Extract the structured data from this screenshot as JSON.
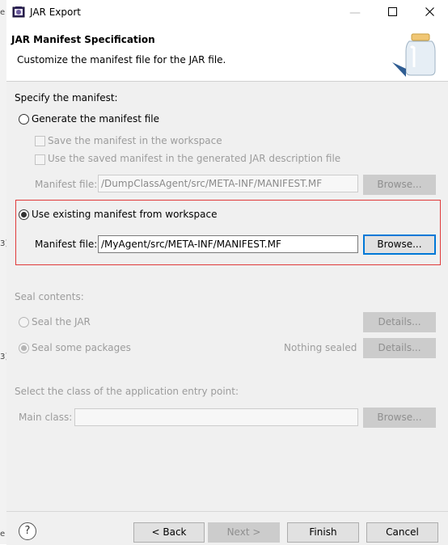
{
  "window": {
    "title": "JAR Export",
    "minimize_glyph": "—",
    "maximize_glyph": "☐",
    "close_glyph": "✕"
  },
  "header": {
    "title": "JAR Manifest Specification",
    "description": "Customize the manifest file for the JAR file."
  },
  "manifest": {
    "section_label": "Specify the manifest:",
    "generate_option": "Generate the manifest file",
    "save_in_workspace": "Save the manifest in the workspace",
    "use_saved_manifest": "Use the saved manifest in the generated JAR description file",
    "generated_file_label": "Manifest file:",
    "generated_file_value": "/DumpClassAgent/src/META-INF/MANIFEST.MF",
    "browse_label": "Browse...",
    "existing_option": "Use existing manifest from workspace",
    "existing_file_label": "Manifest file:",
    "existing_file_value": "/MyAgent/src/META-INF/MANIFEST.MF"
  },
  "seal": {
    "section_label": "Seal contents:",
    "seal_jar": "Seal the JAR",
    "seal_some": "Seal some packages",
    "status": "Nothing sealed",
    "details_label": "Details..."
  },
  "entry": {
    "section_label": "Select the class of the application entry point:",
    "main_class_label": "Main class:",
    "main_class_value": "",
    "browse_label": "Browse..."
  },
  "footer": {
    "help_glyph": "?",
    "back_label": "< Back",
    "next_label": "Next >",
    "finish_label": "Finish",
    "cancel_label": "Cancel"
  },
  "background_fragments": [
    "e",
    "3]",
    "3]",
    "e"
  ]
}
